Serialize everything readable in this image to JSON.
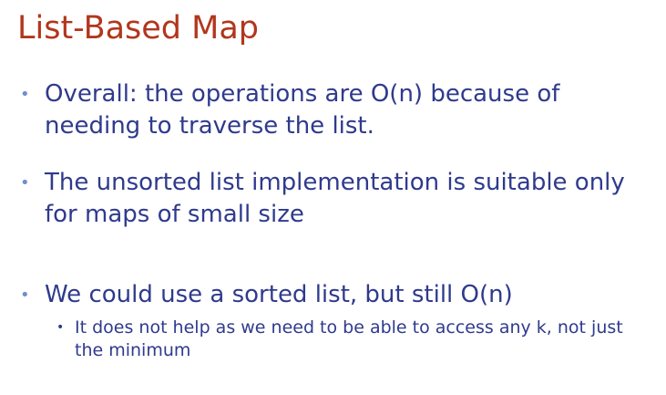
{
  "slide": {
    "title": "List-Based Map",
    "bullets": [
      {
        "text": "Overall: the operations are O(n) because of needing to traverse the list."
      },
      {
        "text": "The unsorted list implementation is suitable only for maps of small size"
      },
      {
        "text": "We could use a sorted list, but still O(n)"
      }
    ],
    "sub_bullets": [
      {
        "text": "It does not help as we need to be able to access any k, not just the minimum"
      }
    ],
    "bullet_glyph": "•",
    "colors": {
      "title": "#b2361c",
      "body_text": "#2f3a8d",
      "bullet": "#6f8fcf"
    }
  }
}
